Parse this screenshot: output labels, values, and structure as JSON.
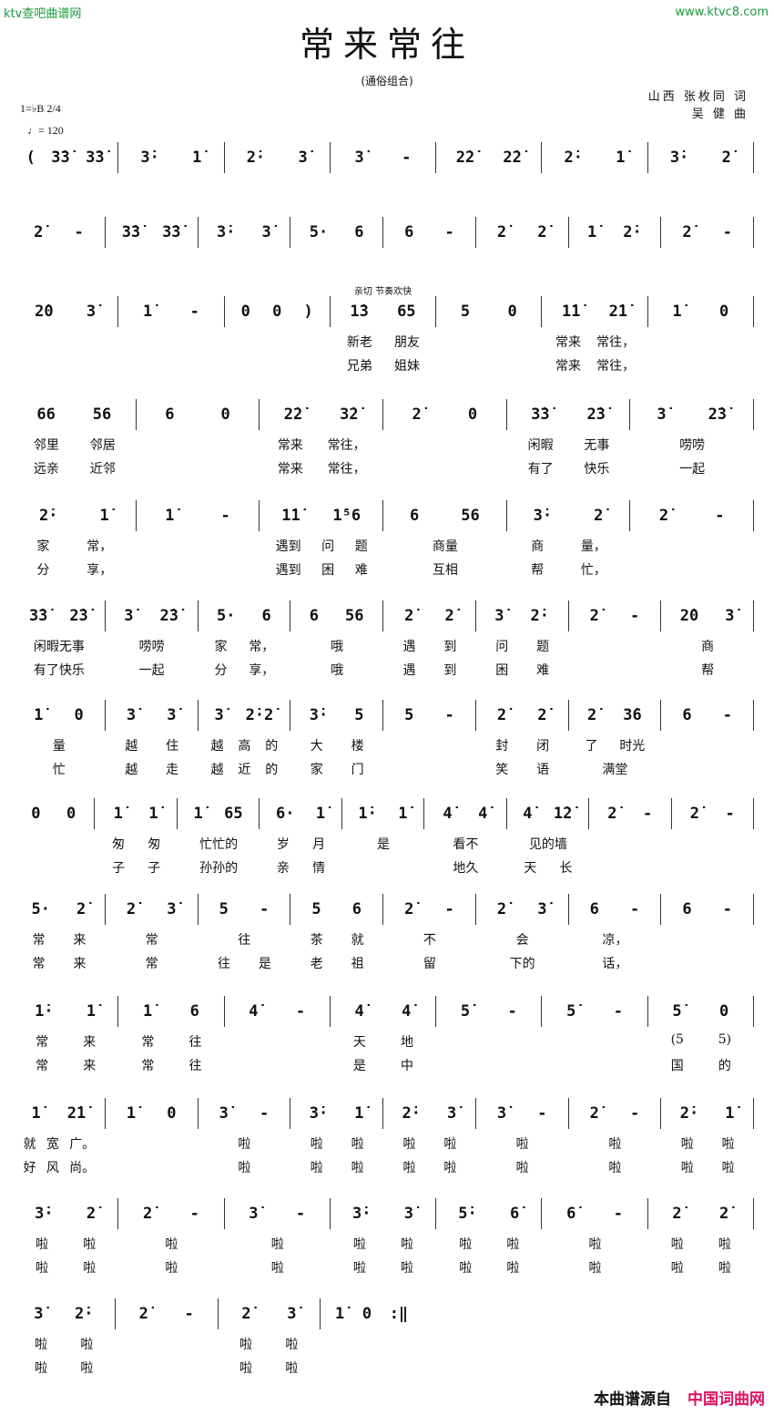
{
  "watermarks": {
    "left": "ktv查吧曲谱网",
    "right": "www.ktvc8.com"
  },
  "title": "常来常往",
  "subtitle": "(通俗组合)",
  "lyricist": "山西  张枚同 词",
  "composer": "吴  健 曲",
  "key": "1=♭B  2/4",
  "tempo": "♩= 120",
  "annotation": "亲切  节奏欢快",
  "footer": {
    "source_label": "本曲谱源自",
    "site_name": "中国词曲网",
    "site_color": "#e01060",
    "watermark_color": "#1a9a3a"
  },
  "systems": [
    {
      "m": [
        {
          "n": "( 3̇3̇ 3̇3̇"
        },
        {
          "n": "3̇· 1̇"
        },
        {
          "n": "2̇· 3̇"
        },
        {
          "n": "3̇ -"
        },
        {
          "n": "2̇2̇ 2̇2̇"
        },
        {
          "n": "2̇· 1̇"
        },
        {
          "n": "3̇· 2̇"
        }
      ]
    },
    {
      "m": [
        {
          "n": "2̇ -"
        },
        {
          "n": "3̇3̇ 3̇3̇"
        },
        {
          "n": "3̇· 3̇"
        },
        {
          "n": "5· 6"
        },
        {
          "n": "6 -"
        },
        {
          "n": "2̇ 2̇"
        },
        {
          "n": "1̇ 2̇·"
        },
        {
          "n": "2̇ -"
        }
      ]
    },
    {
      "m": [
        {
          "n": "2̇0 3̇"
        },
        {
          "n": "1̇ -"
        },
        {
          "n": "0 0 )"
        },
        {
          "n": "1̇3 65",
          "a": true,
          "l": [
            "新老 朋友",
            "兄弟 姐妹"
          ]
        },
        {
          "n": "5 0"
        },
        {
          "n": "1̇1̇ 2̇1̇",
          "l": [
            "常来 常往，",
            "常来 常往，"
          ]
        },
        {
          "n": "1̇ 0"
        }
      ]
    },
    {
      "m": [
        {
          "n": "66 56",
          "l": [
            "邻里 邻居",
            "远亲 近邻"
          ]
        },
        {
          "n": "6 0"
        },
        {
          "n": "2̇2̇ 3̇2̇",
          "l": [
            "常来 常往，",
            "常来 常往，"
          ]
        },
        {
          "n": "2̇ 0"
        },
        {
          "n": "3̇3̇ 2̇3̇",
          "l": [
            "闲暇 无事",
            "有了 快乐"
          ]
        },
        {
          "n": "3̇ 2̇3̇",
          "l": [
            "唠唠",
            "一起"
          ]
        }
      ]
    },
    {
      "m": [
        {
          "n": "2̇· 1̇",
          "l": [
            "家 常，",
            "分 享，"
          ]
        },
        {
          "n": "1̇ -"
        },
        {
          "n": "1̇1̇ 1̇⁵6",
          "l": [
            "遇到 问 题",
            "遇到 困 难"
          ]
        },
        {
          "n": "6 56",
          "l": [
            "商量",
            "互相"
          ]
        },
        {
          "n": "3̇· 2̇",
          "l": [
            "商 量，",
            "帮 忙，"
          ]
        },
        {
          "n": "2̇ -"
        }
      ]
    },
    {
      "m": [
        {
          "n": "3̇3̇ 2̇3̇",
          "l": [
            "闲暇无事",
            "有了快乐"
          ]
        },
        {
          "n": "3̇ 2̇3̇",
          "l": [
            "唠唠",
            "一起"
          ]
        },
        {
          "n": "5· 6",
          "l": [
            "家 常，",
            "分 享，"
          ]
        },
        {
          "n": "6 56",
          "l": [
            "哦",
            "哦"
          ]
        },
        {
          "n": "2̇ 2̇",
          "l": [
            "遇 到",
            "遇 到"
          ]
        },
        {
          "n": "3̇ 2̇·",
          "l": [
            "问 题",
            "困 难"
          ]
        },
        {
          "n": "2̇ -"
        },
        {
          "n": "2̇0 3̇",
          "l": [
            "商",
            "帮"
          ]
        }
      ]
    },
    {
      "m": [
        {
          "n": "1̇ 0",
          "l": [
            "量",
            "忙"
          ]
        },
        {
          "n": "3̇ 3̇",
          "l": [
            "越 住",
            "越 走"
          ]
        },
        {
          "n": "3̇ 2̇·2̇",
          "l": [
            "越 高 的",
            "越 近 的"
          ]
        },
        {
          "n": "3̇· 5",
          "l": [
            "大 楼",
            "家 门"
          ]
        },
        {
          "n": "5 -"
        },
        {
          "n": "2̇ 2̇",
          "l": [
            "封 闭",
            "笑 语"
          ]
        },
        {
          "n": "2̇ 3̇6",
          "l": [
            "了 时光",
            "满堂"
          ]
        },
        {
          "n": "6 -"
        }
      ]
    },
    {
      "m": [
        {
          "n": "0 0"
        },
        {
          "n": "1̇ 1̇",
          "l": [
            "匆 匆",
            "子 子"
          ]
        },
        {
          "n": "1̇ 65",
          "l": [
            "忙忙的",
            "孙孙的"
          ]
        },
        {
          "n": "6· 1̇",
          "l": [
            "岁 月",
            "亲 情"
          ]
        },
        {
          "n": "1̇· 1̇",
          "l": [
            "是",
            ""
          ]
        },
        {
          "n": "4̇ 4̇",
          "l": [
            "看不",
            "地久"
          ]
        },
        {
          "n": "4̇ 1̇2̇",
          "l": [
            "见的墙",
            "天 长"
          ]
        },
        {
          "n": "2̇ -"
        },
        {
          "n": "2̇ -"
        }
      ]
    },
    {
      "m": [
        {
          "n": "5· 2̇",
          "l": [
            "常 来",
            "常 来"
          ]
        },
        {
          "n": "2̇ 3̇",
          "l": [
            "常",
            "常"
          ]
        },
        {
          "n": "5 -",
          "l": [
            "往",
            "往 是"
          ]
        },
        {
          "n": "5 6",
          "l": [
            "茶 就",
            "老 祖"
          ]
        },
        {
          "n": "2̇ -",
          "l": [
            "不",
            "留"
          ]
        },
        {
          "n": "2̇ 3̇",
          "l": [
            "会",
            "下的"
          ]
        },
        {
          "n": "6 -",
          "l": [
            "凉，",
            "话，"
          ]
        },
        {
          "n": "6 -"
        }
      ]
    },
    {
      "m": [
        {
          "n": "1̇· 1̇",
          "l": [
            "常 来",
            "常 来"
          ]
        },
        {
          "n": "1̇ 6",
          "l": [
            "常 往",
            "常 往"
          ]
        },
        {
          "n": "4̇ -"
        },
        {
          "n": "4̇ 4̇",
          "l": [
            "天 地",
            "是 中"
          ]
        },
        {
          "n": "5̇ -"
        },
        {
          "n": "5̇ -"
        },
        {
          "n": "5̇ 0",
          "l": [
            "(5 5)",
            "国 的"
          ]
        }
      ]
    },
    {
      "m": [
        {
          "n": "1̇ 2̇1̇",
          "l": [
            "就 宽 广。",
            "好 风 尚。"
          ]
        },
        {
          "n": "1̇ 0"
        },
        {
          "n": "3̇ -",
          "l": [
            "啦",
            "啦"
          ]
        },
        {
          "n": "3̇· 1̇",
          "l": [
            "啦 啦",
            "啦 啦"
          ]
        },
        {
          "n": "2̇· 3̇",
          "l": [
            "啦 啦",
            "啦 啦"
          ]
        },
        {
          "n": "3̇ -",
          "l": [
            "啦",
            "啦"
          ]
        },
        {
          "n": "2̇ -",
          "l": [
            "啦",
            "啦"
          ]
        },
        {
          "n": "2̇· 1̇",
          "l": [
            "啦 啦",
            "啦 啦"
          ]
        }
      ]
    },
    {
      "m": [
        {
          "n": "3̇· 2̇",
          "l": [
            "啦 啦",
            "啦 啦"
          ]
        },
        {
          "n": "2̇ -",
          "l": [
            "啦",
            "啦"
          ]
        },
        {
          "n": "3̇ -",
          "l": [
            "啦",
            "啦"
          ]
        },
        {
          "n": "3̇· 3̇",
          "l": [
            "啦 啦",
            "啦 啦"
          ]
        },
        {
          "n": "5̇· 6̇",
          "l": [
            "啦 啦",
            "啦 啦"
          ]
        },
        {
          "n": "6̇ -",
          "l": [
            "啦",
            "啦"
          ]
        },
        {
          "n": "2̇ 2̇",
          "l": [
            "啦 啦",
            "啦 啦"
          ]
        }
      ]
    },
    {
      "partial": true,
      "m": [
        {
          "n": "3̇ 2̇·",
          "l": [
            "啦 啦",
            "啦 啦"
          ]
        },
        {
          "n": "2̇ -"
        },
        {
          "n": "2̇ 3̇",
          "l": [
            "啦 啦",
            "啦 啦"
          ]
        },
        {
          "n": "1̇ 0 :‖"
        }
      ]
    }
  ]
}
